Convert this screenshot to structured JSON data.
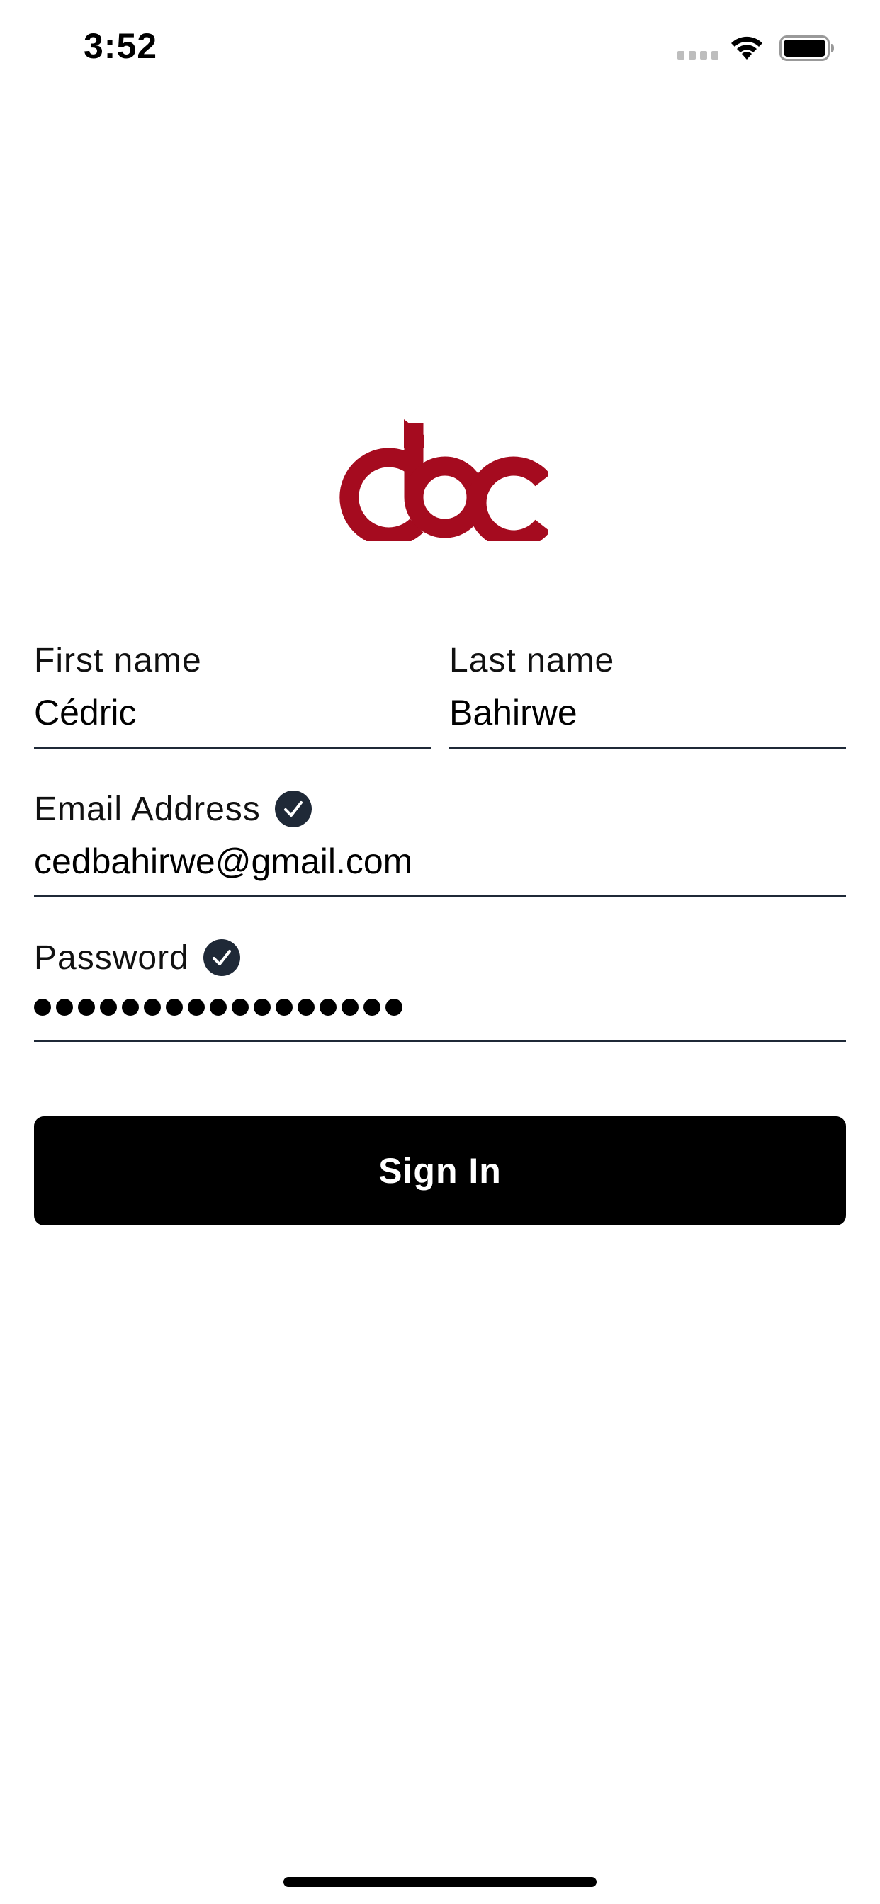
{
  "status_bar": {
    "time": "3:52"
  },
  "logo": {
    "alt": "abc",
    "color": "#a50b1f"
  },
  "form": {
    "first_name": {
      "label": "First name",
      "value": "Cédric"
    },
    "last_name": {
      "label": "Last name",
      "value": "Bahirwe"
    },
    "email": {
      "label": "Email Address",
      "value": "cedbahirwe@gmail.com",
      "validated": true
    },
    "password": {
      "label": "Password",
      "masked_length": 17,
      "validated": true
    }
  },
  "buttons": {
    "sign_in": "Sign In"
  },
  "colors": {
    "brand": "#a50b1f",
    "check_badge": "#1f2937",
    "button_bg": "#000000",
    "button_text": "#ffffff"
  },
  "icons": {
    "check": "checkmark-circle-icon",
    "wifi": "wifi-icon",
    "battery": "battery-icon",
    "signal": "cellular-signal-icon"
  }
}
